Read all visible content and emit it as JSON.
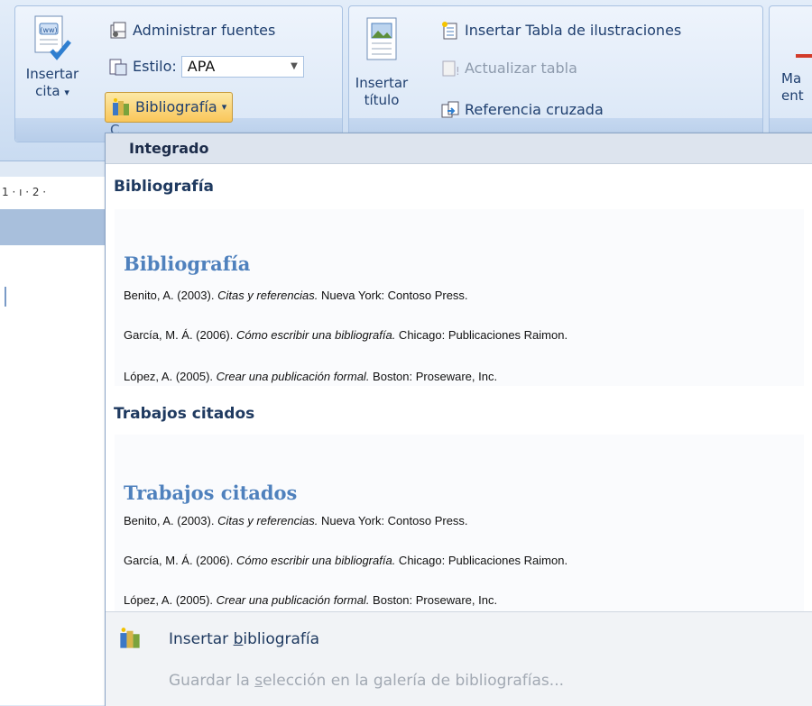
{
  "ribbon": {
    "insert_citation": {
      "line1": "Insertar",
      "line2": "cita",
      "arrow": "▾"
    },
    "manage_sources": "Administrar fuentes",
    "style": {
      "label": "Estilo:",
      "value": "APA"
    },
    "bibliography_button": "Bibliografía",
    "group_name_partial": "C",
    "insert_caption": {
      "line1": "Insertar",
      "line2": "título"
    },
    "insert_table_of_figures": "Insertar Tabla de ilustraciones",
    "update_table": "Actualizar tabla",
    "cross_reference": "Referencia cruzada",
    "mark_entry": {
      "line1": "Ma",
      "line2": "ent"
    }
  },
  "ruler_text": "1 · ı · 2 ·",
  "menu": {
    "header": "Integrado",
    "sections": [
      {
        "label": "Bibliografía",
        "preview_title": "Bibliografía",
        "entries": [
          {
            "pre": "Benito, A. (2003). ",
            "title": "Citas y referencias.",
            "post": " Nueva York: Contoso Press."
          },
          {
            "pre": "García, M. Á. (2006). ",
            "title": "Cómo escribir una bibliografía.",
            "post": " Chicago: Publicaciones Raimon."
          },
          {
            "pre": "López, A. (2005). ",
            "title": "Crear una publicación formal.",
            "post": " Boston: Proseware, Inc."
          }
        ]
      },
      {
        "label": "Trabajos citados",
        "preview_title": "Trabajos citados",
        "entries": [
          {
            "pre": "Benito, A. (2003). ",
            "title": "Citas y referencias.",
            "post": " Nueva York: Contoso Press."
          },
          {
            "pre": "García, M. Á. (2006). ",
            "title": "Cómo escribir una bibliografía.",
            "post": " Chicago: Publicaciones Raimon."
          },
          {
            "pre": "López, A. (2005). ",
            "title": "Crear una publicación formal.",
            "post": " Boston: Proseware, Inc."
          }
        ]
      }
    ],
    "insert_bibliography": {
      "pre": "Insertar ",
      "u": "b",
      "post": "ibliografía"
    },
    "save_selection": {
      "pre": "Guardar la ",
      "u": "s",
      "post": "elección en la galería de bibliografías..."
    }
  },
  "colors": {
    "accent": "#4f81bd",
    "ribbon": "#d6e4f5",
    "header": "#dde4ee"
  },
  "icons": [
    "insert-citation-icon",
    "manage-sources-icon",
    "style-icon",
    "bibliography-icon",
    "insert-caption-icon",
    "table-of-figures-icon",
    "update-table-icon",
    "cross-reference-icon"
  ]
}
